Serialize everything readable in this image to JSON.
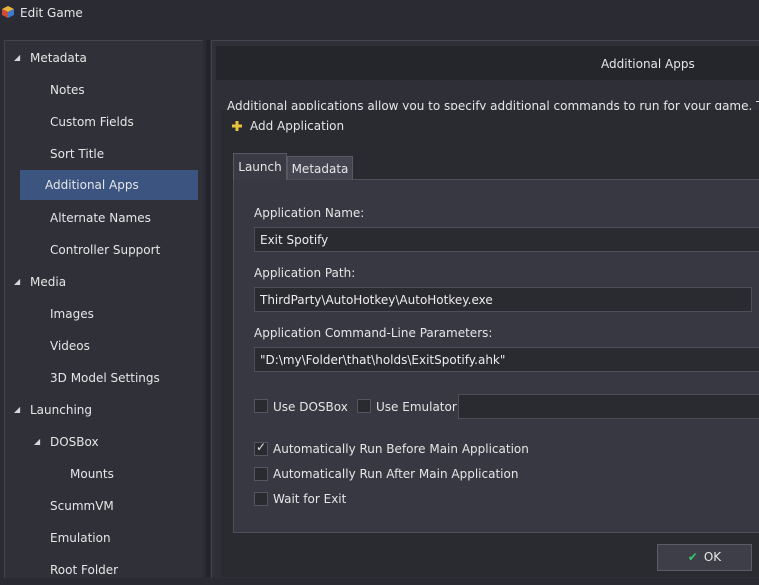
{
  "window": {
    "title": "Edit Game"
  },
  "sidebar": {
    "metadata": {
      "label": "Metadata",
      "items": [
        "Notes",
        "Custom Fields",
        "Sort Title",
        "Additional Apps",
        "Alternate Names",
        "Controller Support"
      ]
    },
    "media": {
      "label": "Media",
      "items": [
        "Images",
        "Videos",
        "3D Model Settings"
      ]
    },
    "launching": {
      "label": "Launching",
      "dosbox": {
        "label": "DOSBox",
        "items": [
          "Mounts"
        ]
      },
      "items": [
        "ScummVM",
        "Emulation",
        "Root Folder"
      ]
    },
    "selected": "Additional Apps"
  },
  "panel": {
    "title": "Additional Apps",
    "description": "Additional applications allow you to specify additional commands to run for your game.  These comm"
  },
  "dialog": {
    "title": "Add Application",
    "tabs": {
      "launch": "Launch",
      "metadata": "Metadata"
    },
    "name_label": "Application Name:",
    "name_value": "Exit Spotify",
    "path_label": "Application Path:",
    "path_value": "ThirdParty\\AutoHotkey\\AutoHotkey.exe",
    "params_label": "Application Command-Line Parameters:",
    "params_value": "\"D:\\my\\Folder\\that\\holds\\ExitSpotify.ahk\"",
    "use_dosbox": {
      "label": "Use DOSBox",
      "checked": false
    },
    "use_emulator": {
      "label": "Use Emulator:",
      "checked": false,
      "value": ""
    },
    "run_before": {
      "label": "Automatically Run Before Main Application",
      "checked": true
    },
    "run_after": {
      "label": "Automatically Run After Main Application",
      "checked": false
    },
    "wait_exit": {
      "label": "Wait for Exit",
      "checked": false
    },
    "ok_label": "OK"
  },
  "colors": {
    "selected": "#3b5480",
    "ok_check": "#37c46b",
    "background": "#2b2b33"
  }
}
